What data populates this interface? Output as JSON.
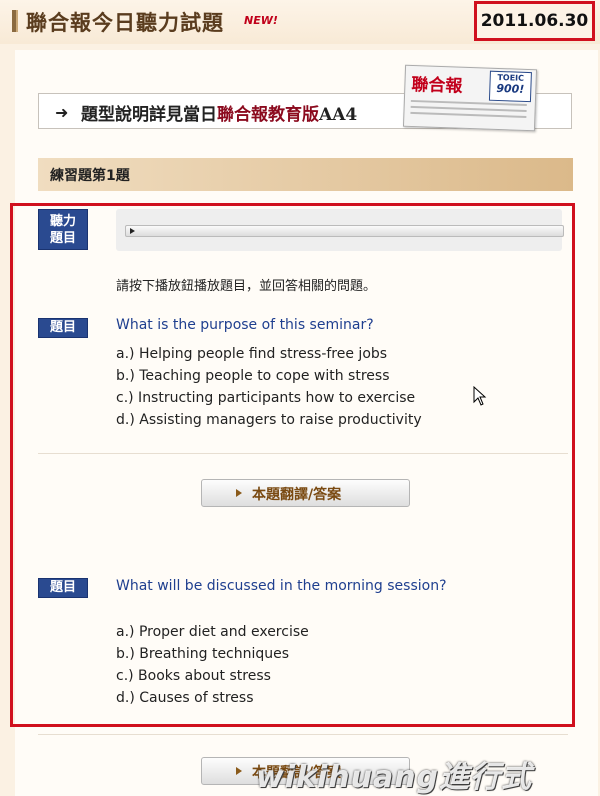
{
  "header": {
    "title": "聯合報今日聽力試題",
    "new_badge": "NEW!",
    "date": "2011.06.30"
  },
  "info_bar": {
    "prefix": "題型說明詳見當日",
    "highlight": "聯合報教育版",
    "suffix": "AA4"
  },
  "paper_graphic": {
    "logo": "聯合報",
    "badge_line1": "TOEIC",
    "badge_line2": "900!"
  },
  "section": {
    "title": "練習題第1題"
  },
  "listening": {
    "tag": "聽力題目",
    "tag_line1": "聽力",
    "tag_line2": "題目",
    "instruction": "請按下播放鈕播放題目，並回答相關的問題。"
  },
  "questions": [
    {
      "tag": "題目",
      "text": "What is the purpose of this seminar?",
      "options": [
        "a.) Helping people find stress-free jobs",
        "b.) Teaching people to cope with stress",
        "c.) Instructing participants how to exercise",
        "d.) Assisting managers to raise productivity"
      ],
      "button_label": "本題翻譯/答案"
    },
    {
      "tag": "題目",
      "text": "What will be discussed in the morning session?",
      "options": [
        "a.) Proper diet and exercise",
        "b.) Breathing techniques",
        "c.) Books about stress",
        "d.) Causes of stress"
      ],
      "button_label": "本題翻譯/答案"
    }
  ],
  "next_button_label": "本題翻譯/答案",
  "watermark": "wikihuang進行式",
  "colors": {
    "accent_red": "#d0101e",
    "tag_blue": "#2a4a90",
    "question_blue": "#1f3f8f",
    "brand_red": "#8b0a1e"
  }
}
